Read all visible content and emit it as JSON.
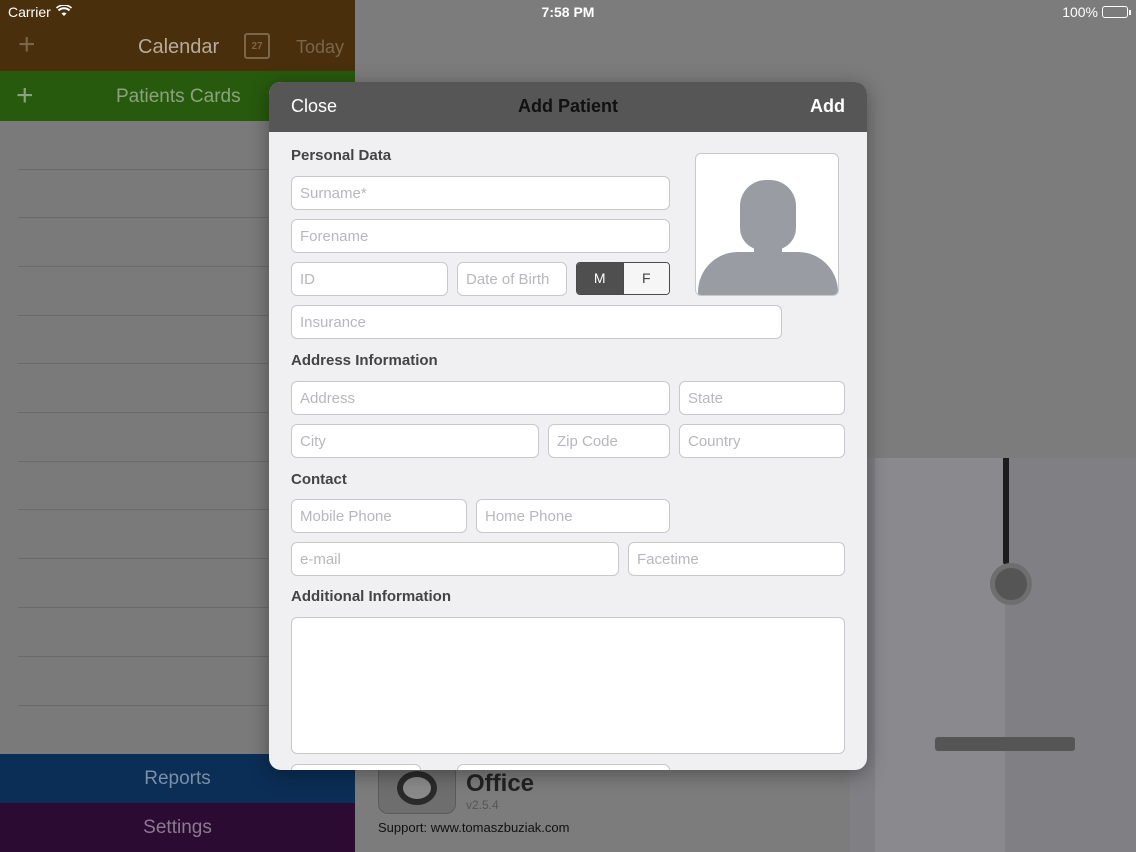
{
  "status_bar": {
    "carrier": "Carrier",
    "time": "7:58 PM",
    "battery": "100%"
  },
  "sidebar": {
    "calendar": {
      "label": "Calendar",
      "date_icon": "27",
      "today": "Today"
    },
    "patients": {
      "label": "Patients Cards"
    },
    "reports": "Reports",
    "settings": "Settings"
  },
  "background": {
    "brand_name": "Office",
    "version": "v2.5.4",
    "support_label": "Support: ",
    "support_url": "www.tomaszbuziak.com"
  },
  "modal": {
    "close_label": "Close",
    "title": "Add Patient",
    "add_label": "Add",
    "sections": {
      "personal": "Personal Data",
      "address": "Address Information",
      "contact": "Contact",
      "additional": "Additional Information"
    },
    "placeholders": {
      "surname": "Surname*",
      "forename": "Forename",
      "id": "ID",
      "dob": "Date of Birth",
      "insurance": "Insurance",
      "address": "Address",
      "state": "State",
      "city": "City",
      "zip": "Zip Code",
      "country": "Country",
      "mobile": "Mobile Phone",
      "home": "Home Phone",
      "email": "e-mail",
      "facetime": "Facetime"
    },
    "gender": {
      "male": "M",
      "female": "F",
      "selected": "M"
    }
  },
  "icons": {
    "wifi": "wifi-icon",
    "battery": "battery-icon",
    "add": "plus-icon",
    "calendar": "calendar-icon",
    "avatar": "avatar-placeholder-icon",
    "app": "stethoscope-icon"
  }
}
